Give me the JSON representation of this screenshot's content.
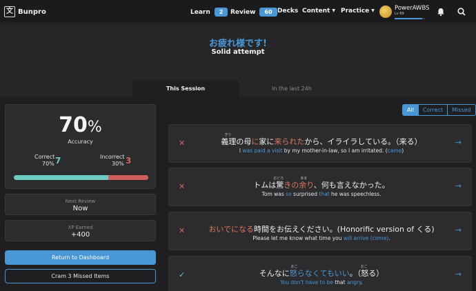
{
  "nav": {
    "brand": "Bunpro",
    "logo_glyph": "文",
    "learn_label": "Learn",
    "learn_count": "2",
    "review_label": "Review",
    "review_count": "60",
    "decks_label": "Decks",
    "content_label": "Content",
    "practice_label": "Practice",
    "user_name": "PowerAWBS",
    "user_level": "Lv 69",
    "user_progress": 0.9,
    "bell_icon": "bell-icon",
    "search_icon": "search-icon"
  },
  "header": {
    "greeting": "お疲れ様です!",
    "subtitle": "Solid attempt",
    "tab_session": "This Session",
    "tab_last24": "In the last 24h"
  },
  "stats": {
    "accuracy_value": "70",
    "accuracy_unit": "%",
    "accuracy_label": "Accuracy",
    "correct_label": "Correct",
    "correct_pct": "70%",
    "correct_count": "7",
    "incorrect_label": "Incorrect",
    "incorrect_pct": "30%",
    "incorrect_count": "3",
    "correct_fraction": 0.7,
    "next_review_label": "Next Review",
    "next_review_value": "Now",
    "xp_label": "XP Earned",
    "xp_value": "+400",
    "return_button": "Return to Dashboard",
    "cram_button": "Cram 3 Missed Items"
  },
  "filter": {
    "all": "All",
    "correct": "Correct",
    "missed": "Missed"
  },
  "reviews": [
    {
      "status": "wrong",
      "mark": "✕",
      "jp_pre": "義理の母",
      "jp_hl1": "に",
      "jp_mid": "家に",
      "jp_hl2": "来られた",
      "jp_post": "から、イライラしている。（来る）",
      "furigana": "ぎり",
      "en_pre": "I ",
      "en_hl": "was paid a visit",
      "en_post": " by my mother-in-law, so I am irritated. (",
      "en_hl2": "came",
      "en_end": ")"
    },
    {
      "status": "wrong",
      "mark": "✕",
      "jp_pre": "トムは驚",
      "jp_hl1": "きの余り",
      "jp_post": "、何も言えなかった。",
      "furigana_a": "おどろ",
      "furigana_b": "あま",
      "en_pre": "Tom was ",
      "en_hl": "so",
      "en_mid": " surprised ",
      "en_hl2": "that",
      "en_post": " he was speechless."
    },
    {
      "status": "wrong",
      "mark": "✕",
      "jp_hl1": "おいでになる",
      "jp_post": "時間をお伝えください。(Honorific version of くる)",
      "en_pre": "Please let me know what time you ",
      "en_hl": "will arrive (come)",
      "en_post": "."
    },
    {
      "status": "right",
      "mark": "✓",
      "jp_pre": "そんなに",
      "jp_hl1": "怒らなくてもいい",
      "jp_post": "。（怒る）",
      "furigana_a": "おこ",
      "furigana_b": "おこ",
      "en_hl": "You don't have to be",
      "en_mid": " that ",
      "en_hl2": "angry",
      "en_post": "."
    }
  ],
  "colors": {
    "accent": "#4a97d6",
    "correct": "#6ccac0",
    "incorrect": "#cc5f5a",
    "highlight_red": "#df7560"
  }
}
